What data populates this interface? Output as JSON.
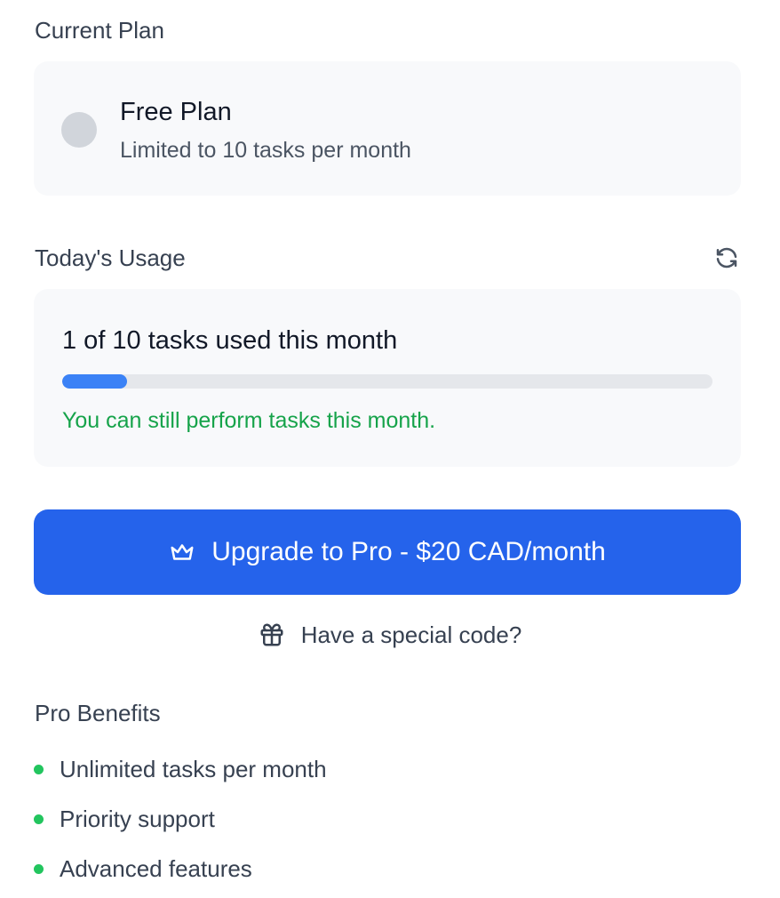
{
  "current_plan": {
    "section_title": "Current Plan",
    "plan_name": "Free Plan",
    "plan_description": "Limited to 10 tasks per month"
  },
  "usage": {
    "section_title": "Today's Usage",
    "refresh_icon": "refresh-icon",
    "summary": "1 of 10 tasks used this month",
    "used": 1,
    "limit": 10,
    "progress_fraction": 0.1,
    "status_message": "You can still perform tasks this month."
  },
  "upgrade": {
    "icon": "crown-icon",
    "label": "Upgrade to Pro - $20 CAD/month"
  },
  "special_code": {
    "icon": "gift-icon",
    "label": "Have a special code?"
  },
  "benefits": {
    "section_title": "Pro Benefits",
    "items": [
      "Unlimited tasks per month",
      "Priority support",
      "Advanced features"
    ]
  },
  "colors": {
    "accent": "#2563eb",
    "progress": "#3b82f6",
    "success": "#16a34a",
    "bullet": "#22c55e",
    "card_background": "#f8f9fb"
  }
}
